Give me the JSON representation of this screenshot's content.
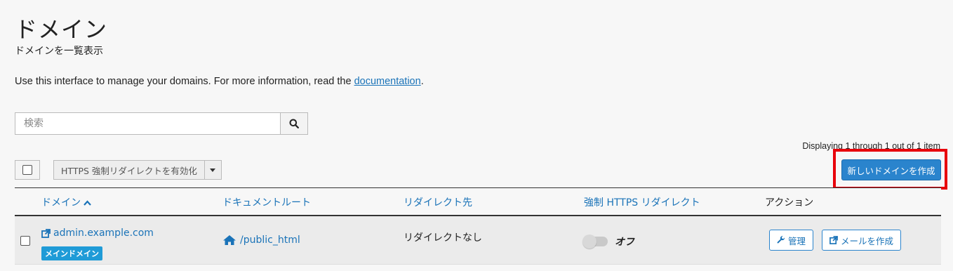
{
  "page": {
    "title": "ドメイン",
    "subtitle": "ドメインを一覧表示",
    "intro_text": "Use this interface to manage your domains. For more information, read the ",
    "intro_link": "documentation",
    "intro_end": "."
  },
  "search": {
    "placeholder": "検索"
  },
  "toolbar": {
    "count_text": "Displaying 1 through 1 out of 1 item",
    "https_button": "HTTPS 強制リダイレクトを有効化",
    "create_button": "新しいドメインを作成"
  },
  "table": {
    "headers": {
      "domain": "ドメイン",
      "docroot": "ドキュメントルート",
      "redirect": "リダイレクト先",
      "https": "強制 HTTPS リダイレクト",
      "actions": "アクション"
    },
    "rows": [
      {
        "domain": "admin.example.com",
        "badge": "メインドメイン",
        "docroot": "/public_html",
        "redirect": "リダイレクトなし",
        "https_state": "オフ",
        "manage": "管理",
        "create_email": "メールを作成"
      }
    ]
  },
  "colors": {
    "accent": "#2a84cd",
    "link": "#1a73b8",
    "highlight": "#e8000b",
    "badge": "#1f9bd7"
  }
}
